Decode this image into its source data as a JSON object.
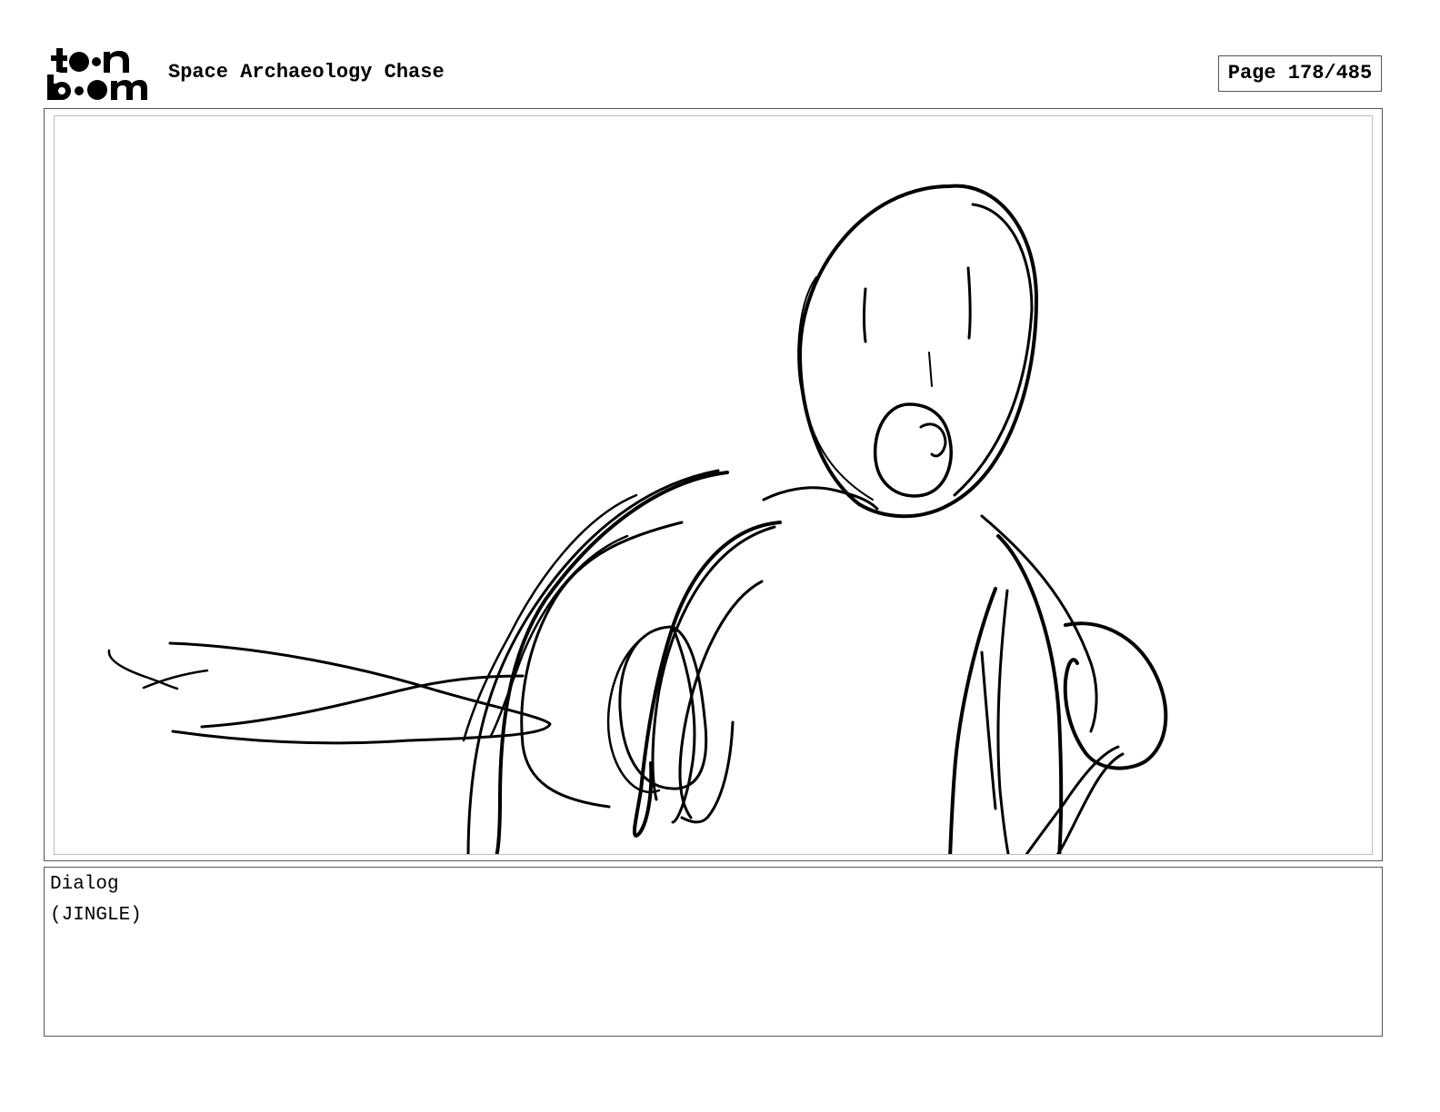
{
  "header": {
    "title": "Space Archaeology Chase",
    "page_label": "Page 178/485"
  },
  "logo": {
    "name": "toon boom",
    "top_text": "toon",
    "bottom_text": "boom"
  },
  "panel": {
    "drawing": "sketch-figure-open-mouth"
  },
  "dialog": {
    "label": "Dialog",
    "text": "(JINGLE)"
  }
}
